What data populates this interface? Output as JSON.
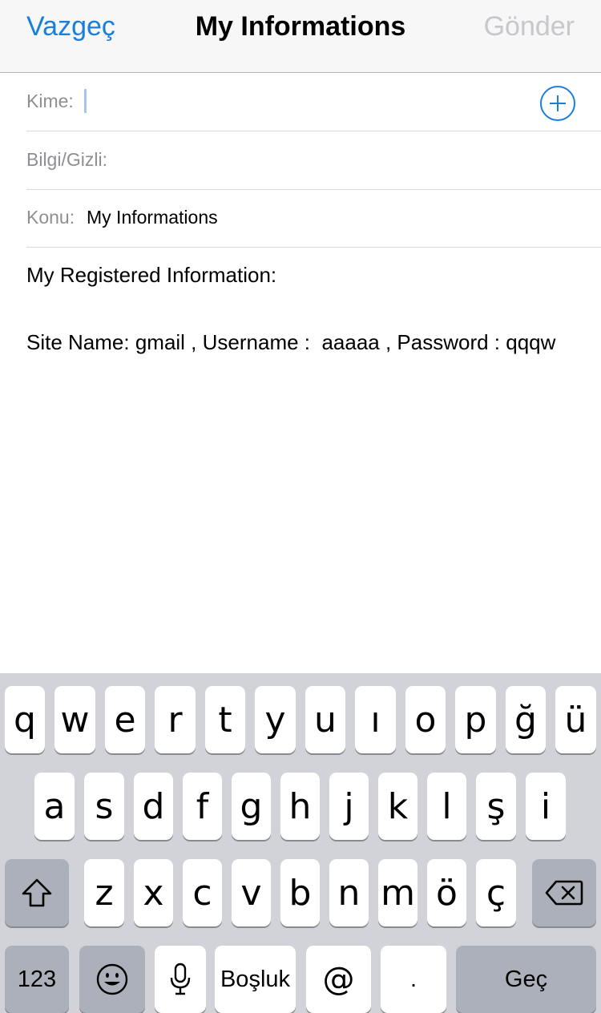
{
  "navbar": {
    "cancel_label": "Vazgeç",
    "title": "My Informations",
    "send_label": "Gönder"
  },
  "fields": {
    "to": {
      "label": "Kime:",
      "value": ""
    },
    "cc_bcc": {
      "label": "Bilgi/Gizli:"
    },
    "subject": {
      "label": "Konu:",
      "value": "My Informations"
    }
  },
  "body": {
    "line1": "My Registered Information:",
    "line2": "",
    "line3": "Site Name: gmail , Username :  aaaaa , Password : qqqw"
  },
  "keyboard": {
    "row1": [
      "q",
      "w",
      "e",
      "r",
      "t",
      "y",
      "u",
      "ı",
      "o",
      "p",
      "ğ",
      "ü"
    ],
    "row2": [
      "a",
      "s",
      "d",
      "f",
      "g",
      "h",
      "j",
      "k",
      "l",
      "ş",
      "i"
    ],
    "row3": [
      "z",
      "x",
      "c",
      "v",
      "b",
      "n",
      "m",
      "ö",
      "ç"
    ],
    "numbers_label": "123",
    "space_label": "Boşluk",
    "at_label": "@",
    "period_label": ".",
    "return_label": "Geç",
    "icons": [
      "shift-icon",
      "backspace-icon",
      "emoji-icon",
      "microphone-icon",
      "add-contact-icon"
    ]
  },
  "colors": {
    "accent": "#1a7fdc",
    "disabled": "#c7c7cc",
    "keyboard_bg": "#d1d3d9",
    "key_dark": "#abb0ba"
  }
}
